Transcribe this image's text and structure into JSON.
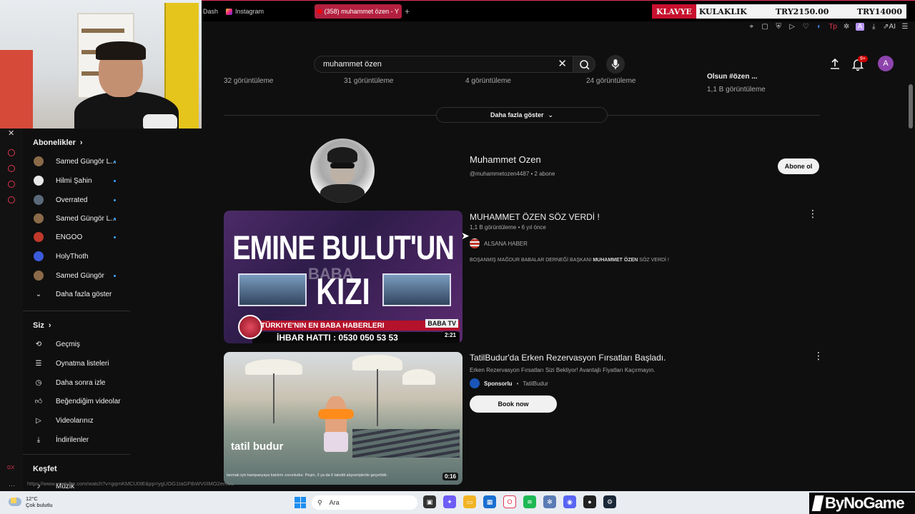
{
  "browser": {
    "tabs": [
      {
        "label": "Dash"
      },
      {
        "label": "Instagram"
      },
      {
        "label": "(358) muhammet özen - Y"
      }
    ],
    "new_tab": "+",
    "toolbar_ai_label": "AI"
  },
  "ticker": {
    "tag": "KLAVYE",
    "item1": "KULAKLIK",
    "item2": "TRY2150.00",
    "item3": "TRY14000"
  },
  "masthead": {
    "search_value": "muhammet özen",
    "notification_badge": "9+",
    "avatar_letter": "A"
  },
  "guide": {
    "subscriptions_title": "Abonelikler",
    "subscriptions": [
      {
        "label": "Samed Güngör L...",
        "dot": true,
        "color": "#8a6a48"
      },
      {
        "label": "Hilmi Şahin",
        "dot": true,
        "color": "#e8e8e8"
      },
      {
        "label": "Overrated",
        "dot": true,
        "color": "#5a6a7a"
      },
      {
        "label": "Samed Güngör L...",
        "dot": true,
        "color": "#8a6a48"
      },
      {
        "label": "ENGOO",
        "dot": true,
        "color": "#c0392b"
      },
      {
        "label": "HolyThoth",
        "dot": false,
        "color": "#3b5bdb"
      },
      {
        "label": "Samed Güngör",
        "dot": true,
        "color": "#8a6a48"
      }
    ],
    "show_more": "Daha fazla göster",
    "you_title": "Siz",
    "you_items": [
      {
        "label": "Geçmiş",
        "icon": "history-icon"
      },
      {
        "label": "Oynatma listeleri",
        "icon": "playlists-icon"
      },
      {
        "label": "Daha sonra izle",
        "icon": "watch-later-icon"
      },
      {
        "label": "Beğendiğim videolar",
        "icon": "like-icon"
      },
      {
        "label": "Videolarınız",
        "icon": "your-videos-icon"
      },
      {
        "label": "İndirilenler",
        "icon": "download-icon"
      }
    ],
    "explore_title": "Keşfet",
    "explore_items": [
      {
        "label": "Müzik",
        "icon": "music-icon"
      }
    ]
  },
  "side_panel": {
    "label": "GX"
  },
  "results": {
    "top_views": [
      "32 görüntüleme",
      "31 görüntüleme",
      "4 görüntüleme",
      "24 görüntüleme",
      "1,1 B görüntüleme"
    ],
    "top_partial_title": "Olsun #özen ...",
    "show_more": "Daha fazla göster",
    "channel": {
      "name": "Muhammet Ozen",
      "meta": "@muhammetozen4487 • 2 abone",
      "subscribe": "Abone ol"
    },
    "video1": {
      "title": "MUHAMMET ÖZEN SÖZ VERDİ !",
      "meta": "1,1 B görüntüleme • 6 yıl önce",
      "channel": "ALSANA HABER",
      "desc_prefix": "BOŞANMIŞ MAĞDUR BABALAR DERNEĞİ BAŞKANI ",
      "desc_bold": "MUHAMMET ÖZEN",
      "desc_suffix": " SÖZ VERDİ !",
      "duration": "2:21",
      "thumb_line1": "EMINE BULUT'UN",
      "thumb_line2": "KIZI",
      "thumb_watermark": "BABA",
      "thumb_strip": "TÜRKIYE'NIN EN BABA HABERLERI",
      "thumb_tv": "BABA TV",
      "thumb_hotline": "İHBAR HATTI : 0530 050 53 53"
    },
    "video2": {
      "title": "TatilBudur'da Erken Rezervasyon Fırsatları Başladı.",
      "desc": "Erken Rezervasyon Fırsatları Sizi Bekliyor! Avantajlı Fiyatları Kaçırmayın.",
      "sponsored": "Sponsorlu",
      "advertiser": "TatilBudur",
      "cta": "Book now",
      "duration": "0:16",
      "thumb_logo": "tatil budur",
      "thumb_disclaimer": "lanmak için kampanyaya katılımı zorunludur. Peşin, 3 ya da 6 taksitli alışverişlerde geçerlidir."
    }
  },
  "status_url": "https://www.youtube.com/watch?v=gqmKMCU0tE&pp=ygUOG1taGFtbWV0IMO2emVu",
  "taskbar": {
    "temperature": "12°C",
    "weather": "Çok bulutlu",
    "search_placeholder": "Ara",
    "watermark": "ByNoGame"
  }
}
